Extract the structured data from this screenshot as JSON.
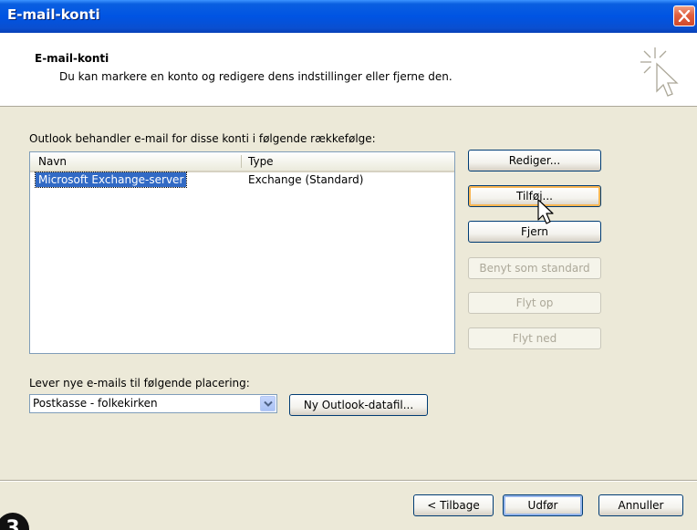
{
  "window": {
    "title": "E-mail-konti"
  },
  "header": {
    "title": "E-mail-konti",
    "subtitle": "Du kan markere en konto og redigere dens indstillinger eller fjerne den."
  },
  "accounts": {
    "label": "Outlook behandler e-mail for disse konti i følgende rækkefølge:",
    "columns": [
      "Navn",
      "Type"
    ],
    "rows": [
      {
        "name": "Microsoft Exchange-server",
        "type": "Exchange (Standard)",
        "selected": true
      }
    ]
  },
  "side_buttons": {
    "edit": "Rediger...",
    "add": "Tilføj...",
    "remove": "Fjern",
    "set_default": "Benyt som standard",
    "move_up": "Flyt op",
    "move_down": "Flyt ned"
  },
  "delivery": {
    "label": "Lever nye e-mails til følgende placering:",
    "selected": "Postkasse - folkekirken",
    "new_file_button": "Ny Outlook-datafil..."
  },
  "footer": {
    "back": "< Tilbage",
    "finish": "Udfør",
    "cancel": "Annuller"
  },
  "badge": "3"
}
